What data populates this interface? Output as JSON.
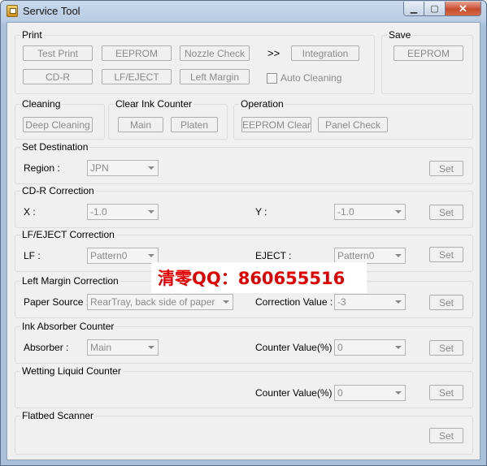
{
  "window": {
    "title": "Service Tool",
    "close_glyph": "✕",
    "min_glyph": "▁",
    "max_glyph": "▢"
  },
  "print": {
    "label": "Print",
    "buttons": [
      "Test Print",
      "EEPROM",
      "Nozzle Check",
      "Integration",
      "CD-R",
      "LF/EJECT",
      "Left Margin"
    ],
    "arrows": ">>",
    "auto_cleaning": {
      "label": "Auto Cleaning",
      "checked": false
    }
  },
  "save": {
    "label": "Save",
    "eeprom": "EEPROM"
  },
  "cleaning": {
    "label": "Cleaning",
    "deep": "Deep Cleaning"
  },
  "clear_ink": {
    "label": "Clear Ink Counter",
    "main": "Main",
    "platen": "Platen"
  },
  "operation": {
    "label": "Operation",
    "eeprom_clear": "EEPROM Clear",
    "panel_check": "Panel Check"
  },
  "set_destination": {
    "label": "Set Destination",
    "region_label": "Region :",
    "region_value": "JPN",
    "set": "Set"
  },
  "cdr_correction": {
    "label": "CD-R Correction",
    "x_label": "X :",
    "x_value": "-1.0",
    "y_label": "Y :",
    "y_value": "-1.0",
    "set": "Set"
  },
  "lf_eject_correction": {
    "label": "LF/EJECT Correction",
    "lf_label": "LF :",
    "lf_value": "Pattern0",
    "eject_label": "EJECT :",
    "eject_value": "Pattern0",
    "set": "Set"
  },
  "left_margin_correction": {
    "label": "Left Margin Correction",
    "paper_label": "Paper Source :",
    "paper_value": "RearTray, back side of paper",
    "corr_label": "Correction Value :",
    "corr_value": "-3",
    "set": "Set"
  },
  "ink_absorber": {
    "label": "Ink Absorber Counter",
    "absorber_label": "Absorber :",
    "absorber_value": "Main",
    "counter_label": "Counter Value(%) :",
    "counter_value": "0",
    "set": "Set"
  },
  "wetting_liquid": {
    "label": "Wetting Liquid Counter",
    "counter_label": "Counter Value(%) :",
    "counter_value": "0",
    "set": "Set"
  },
  "flatbed": {
    "label": "Flatbed Scanner",
    "set": "Set"
  },
  "watermark": {
    "text": "清零QQ：860655516"
  }
}
